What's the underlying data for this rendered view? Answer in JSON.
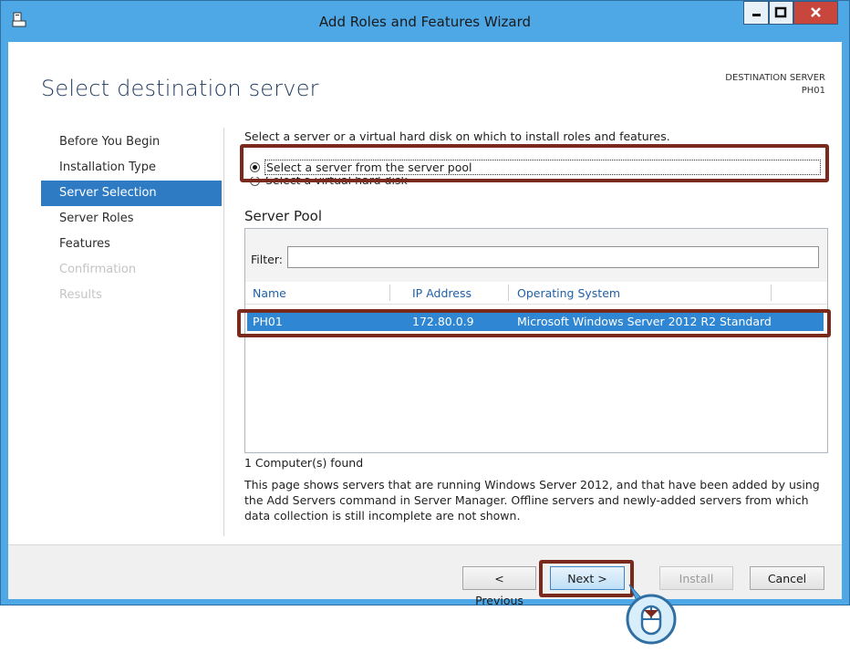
{
  "window": {
    "title": "Add Roles and Features Wizard"
  },
  "header": {
    "page_title": "Select destination server",
    "destination_label": "DESTINATION SERVER",
    "destination_value": "PH01"
  },
  "nav": {
    "items": [
      {
        "label": "Before You Begin",
        "state": "normal"
      },
      {
        "label": "Installation Type",
        "state": "normal"
      },
      {
        "label": "Server Selection",
        "state": "active"
      },
      {
        "label": "Server Roles",
        "state": "normal"
      },
      {
        "label": "Features",
        "state": "normal"
      },
      {
        "label": "Confirmation",
        "state": "disabled"
      },
      {
        "label": "Results",
        "state": "disabled"
      }
    ]
  },
  "main": {
    "instruction": "Select a server or a virtual hard disk on which to install roles and features.",
    "options": [
      {
        "label": "Select a server from the server pool",
        "selected": true
      },
      {
        "label": "Select a virtual hard disk",
        "selected": false
      }
    ],
    "pool_title": "Server Pool",
    "filter_label": "Filter:",
    "filter_value": "",
    "columns": [
      "Name",
      "IP Address",
      "Operating System"
    ],
    "rows": [
      {
        "name": "PH01",
        "ip": "172.80.0.9",
        "os": "Microsoft Windows Server 2012 R2 Standard"
      }
    ],
    "found": "1 Computer(s) found",
    "description": "This page shows servers that are running Windows Server 2012, and that have been added by using the Add Servers command in Server Manager. Offline servers and newly-added servers from which data collection is still incomplete are not shown."
  },
  "footer": {
    "previous": "< Previous",
    "next": "Next >",
    "install": "Install",
    "cancel": "Cancel"
  },
  "colors": {
    "accent": "#2e7bc4",
    "highlight_box": "#7a2a1c",
    "titlebar": "#4ea8e6"
  }
}
